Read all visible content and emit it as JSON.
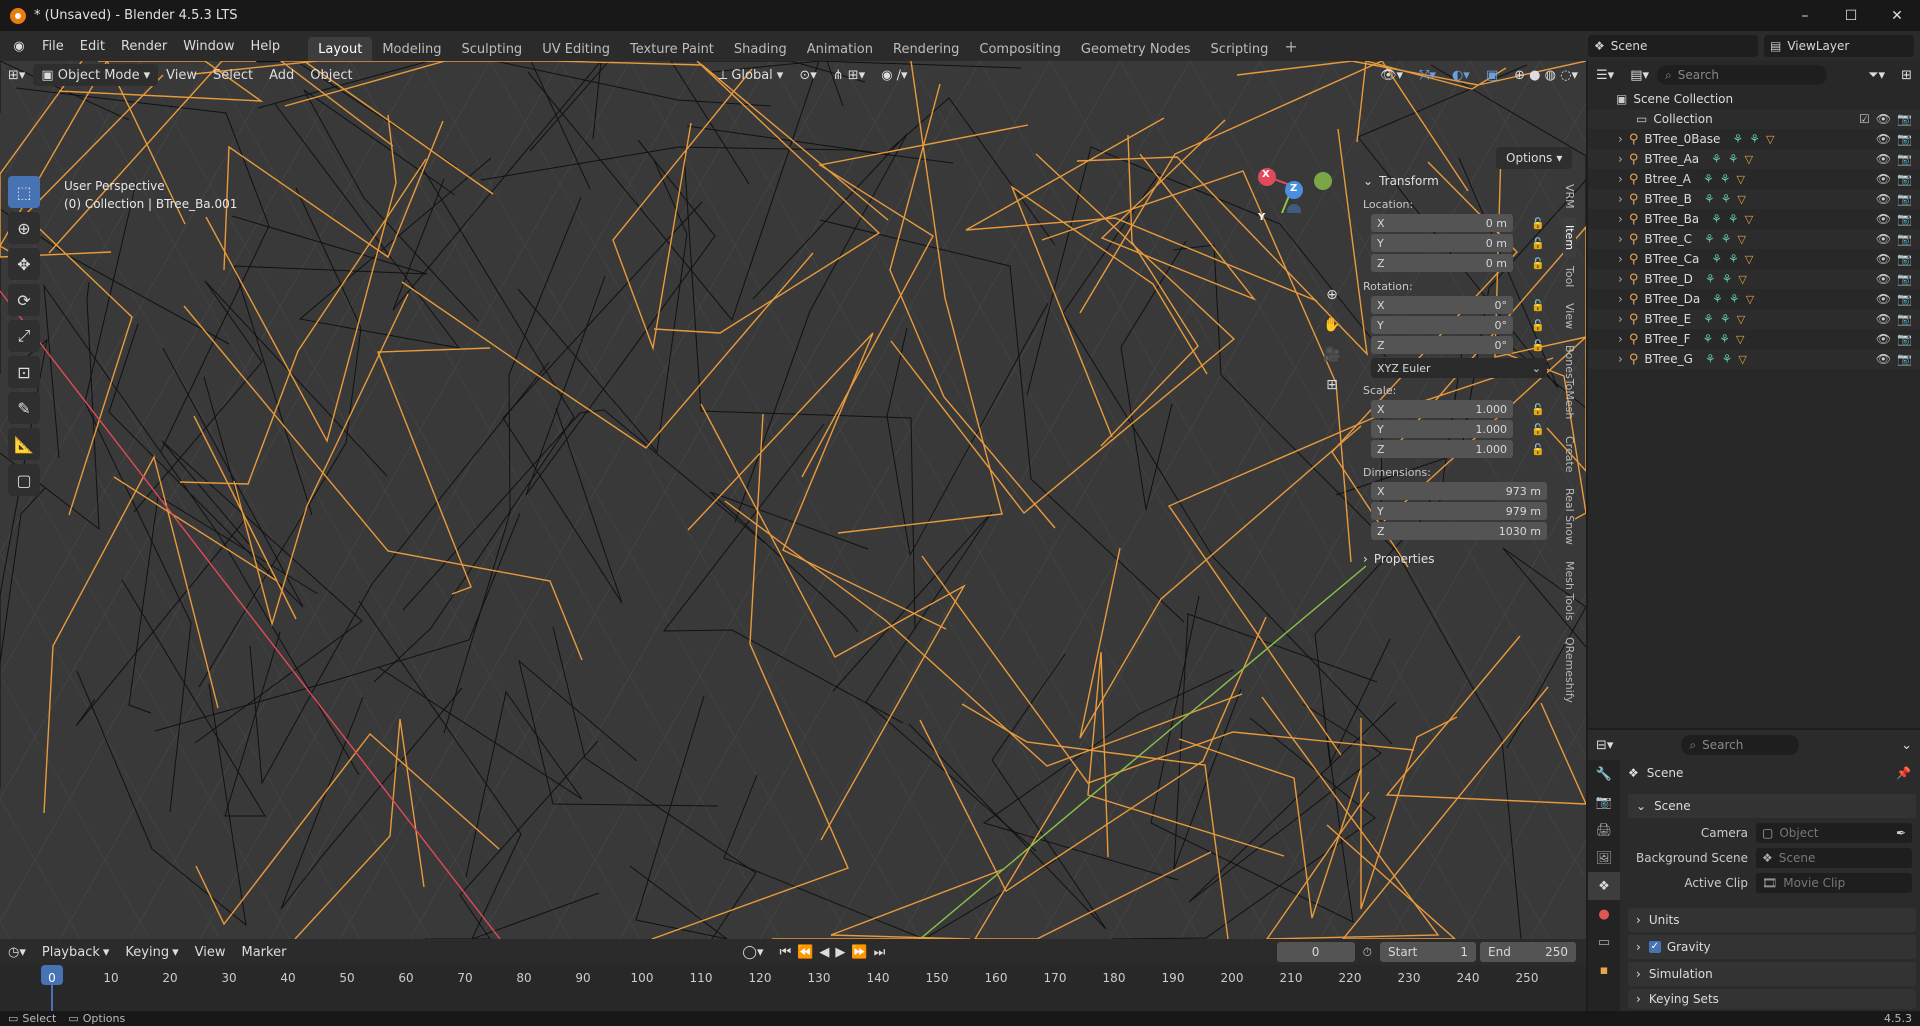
{
  "window": {
    "title": "* (Unsaved) - Blender 4.5.3 LTS",
    "min": "–",
    "max": "☐",
    "close": "✕"
  },
  "menu": [
    "File",
    "Edit",
    "Render",
    "Window",
    "Help"
  ],
  "workspaces": [
    {
      "label": "Layout",
      "active": true
    },
    {
      "label": "Modeling"
    },
    {
      "label": "Sculpting"
    },
    {
      "label": "UV Editing"
    },
    {
      "label": "Texture Paint"
    },
    {
      "label": "Shading"
    },
    {
      "label": "Animation"
    },
    {
      "label": "Rendering"
    },
    {
      "label": "Compositing"
    },
    {
      "label": "Geometry Nodes"
    },
    {
      "label": "Scripting"
    }
  ],
  "scene_name": "Scene",
  "view_layer": "ViewLayer",
  "viewport": {
    "mode": "Object Mode",
    "menus": [
      "View",
      "Select",
      "Add",
      "Object"
    ],
    "orientation": "Global",
    "info_line1": "User Perspective",
    "info_line2": "(0) Collection | BTree_Ba.001",
    "options": "Options",
    "gizmo": {
      "x": "X",
      "y": "Y",
      "z": "Z"
    }
  },
  "npanel": {
    "transform": "Transform",
    "location_label": "Location:",
    "location": [
      {
        "axis": "X",
        "value": "0 m"
      },
      {
        "axis": "Y",
        "value": "0 m"
      },
      {
        "axis": "Z",
        "value": "0 m"
      }
    ],
    "rotation_label": "Rotation:",
    "rotation": [
      {
        "axis": "X",
        "value": "0°"
      },
      {
        "axis": "Y",
        "value": "0°"
      },
      {
        "axis": "Z",
        "value": "0°"
      }
    ],
    "rotation_mode": "XYZ Euler",
    "scale_label": "Scale:",
    "scale": [
      {
        "axis": "X",
        "value": "1.000"
      },
      {
        "axis": "Y",
        "value": "1.000"
      },
      {
        "axis": "Z",
        "value": "1.000"
      }
    ],
    "dimensions_label": "Dimensions:",
    "dimensions": [
      {
        "axis": "X",
        "value": "973 m"
      },
      {
        "axis": "Y",
        "value": "979 m"
      },
      {
        "axis": "Z",
        "value": "1030 m"
      }
    ],
    "properties": "Properties",
    "tabs": [
      "VRM",
      "Item",
      "Tool",
      "View",
      "BonesToMesh",
      "Create",
      "Real Snow",
      "Mesh Tools",
      "QRemeshify"
    ]
  },
  "timeline": {
    "menus": [
      "Playback",
      "Keying",
      "View",
      "Marker"
    ],
    "current_frame": "0",
    "start_label": "Start",
    "start": "1",
    "end_label": "End",
    "end": "250",
    "ticks": [
      "0",
      "10",
      "20",
      "30",
      "40",
      "50",
      "60",
      "70",
      "80",
      "90",
      "100",
      "110",
      "120",
      "130",
      "140",
      "150",
      "160",
      "170",
      "180",
      "190",
      "200",
      "210",
      "220",
      "230",
      "240",
      "250"
    ]
  },
  "statusbar": {
    "select": "Select",
    "options": "Options",
    "version": "4.5.3"
  },
  "outliner": {
    "search_placeholder": "Search",
    "scene_collection": "Scene Collection",
    "collection": "Collection",
    "items": [
      "BTree_0Base",
      "BTree_Aa",
      "Btree_A",
      "BTree_B",
      "BTree_Ba",
      "BTree_C",
      "BTree_Ca",
      "BTree_D",
      "BTree_Da",
      "BTree_E",
      "BTree_F",
      "BTree_G"
    ]
  },
  "properties": {
    "search_placeholder": "Search",
    "context": "Scene",
    "section_scene": "Scene",
    "camera_label": "Camera",
    "camera_placeholder": "Object",
    "bg_scene_label": "Background Scene",
    "bg_scene_placeholder": "Scene",
    "active_clip_label": "Active Clip",
    "active_clip_placeholder": "Movie Clip",
    "sections": [
      "Units",
      "Gravity",
      "Simulation",
      "Keying Sets"
    ]
  },
  "colors": {
    "accent": "#4772b3",
    "wire_selected": "#e89a3c",
    "wire": "#111111",
    "x_axis": "#e04a5a",
    "y_axis": "#8bc34a",
    "z_axis": "#4a8fe0"
  }
}
